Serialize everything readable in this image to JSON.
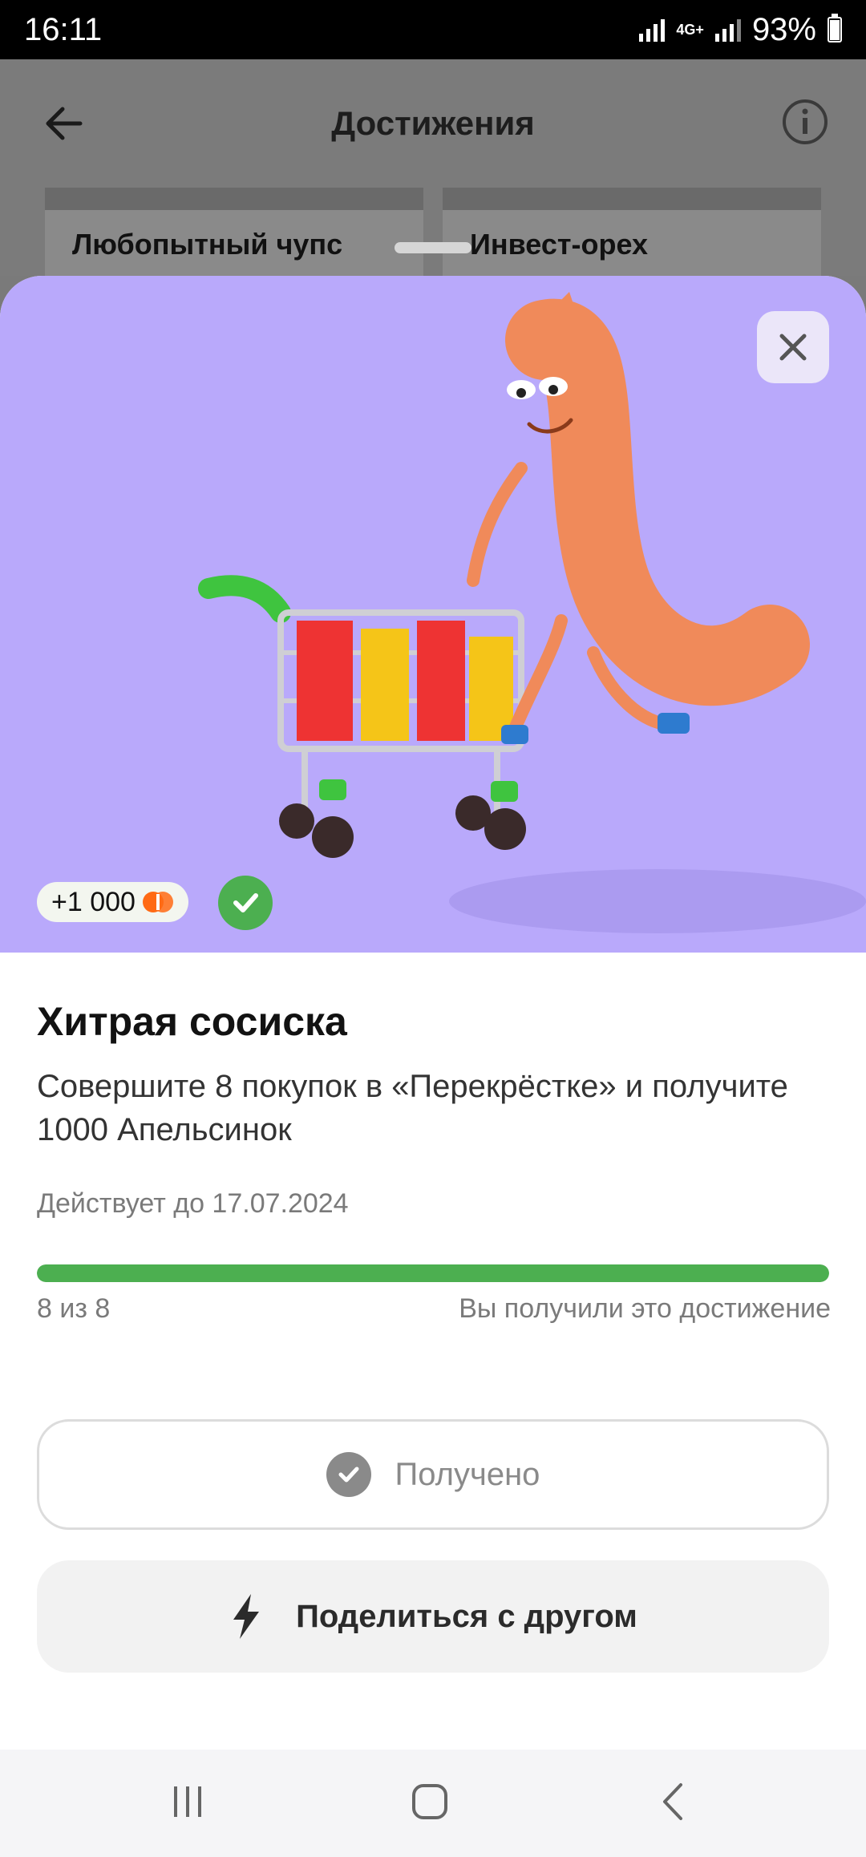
{
  "status_bar": {
    "time": "16:11",
    "network": "4G+",
    "battery": "93%"
  },
  "page": {
    "title": "Достижения"
  },
  "cards": [
    {
      "label": "Любопытный чупс"
    },
    {
      "label": "Инвест-орех"
    }
  ],
  "achievement": {
    "reward": "+1 000",
    "title": "Хитрая сосиска",
    "description": "Совершите 8 покупок в «Перекрёстке» и получите 1000 Апельсинок",
    "valid_until": "Действует до 17.07.2024",
    "progress": {
      "current": 8,
      "total": 8,
      "fraction": 1.0,
      "label": "8 из 8",
      "status": "Вы получили это достижение"
    }
  },
  "buttons": {
    "received": "Получено",
    "share": "Поделиться с другом"
  },
  "colors": {
    "hero_bg": "#b9a9fb",
    "accent_green": "#4caf50",
    "coin_orange": "#ff6a14"
  }
}
